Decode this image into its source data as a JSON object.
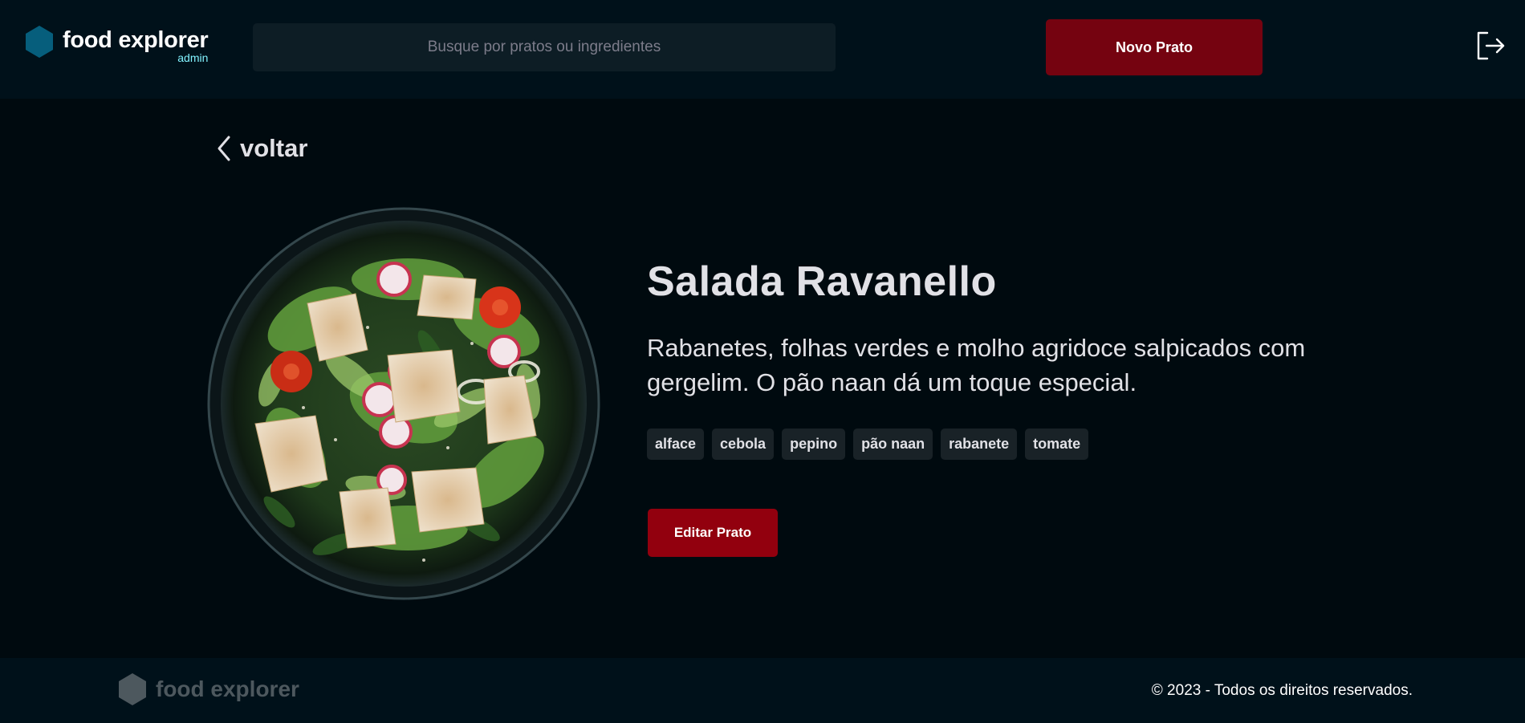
{
  "header": {
    "brand_title": "food explorer",
    "brand_subtitle": "admin",
    "brand_icon": "hexagon-logo-icon",
    "search_placeholder": "Busque por pratos ou ingredientes",
    "new_dish_label": "Novo Prato",
    "logout_icon": "sign-out-icon"
  },
  "back": {
    "label": "voltar",
    "icon": "chevron-left-icon"
  },
  "dish": {
    "title": "Salada Ravanello",
    "description": "Rabanetes, folhas verdes e molho agridoce salpicados com gergelim. O pão naan dá um toque especial.",
    "ingredients": [
      "alface",
      "cebola",
      "pepino",
      "pão naan",
      "rabanete",
      "tomate"
    ],
    "edit_label": "Editar Prato"
  },
  "footer": {
    "brand_title": "food explorer",
    "copyright": "© 2023 - Todos os direitos reservados."
  },
  "colors": {
    "background": "#000A0F",
    "header_bg": "#00111A",
    "search_bg": "#0D1D25",
    "primary_button": "#750310",
    "edit_button": "#92000E",
    "tag_bg": "#192227",
    "brand_accent": "#065E7C",
    "admin_label": "#82F3FF",
    "footer_muted": "#4D585E"
  }
}
